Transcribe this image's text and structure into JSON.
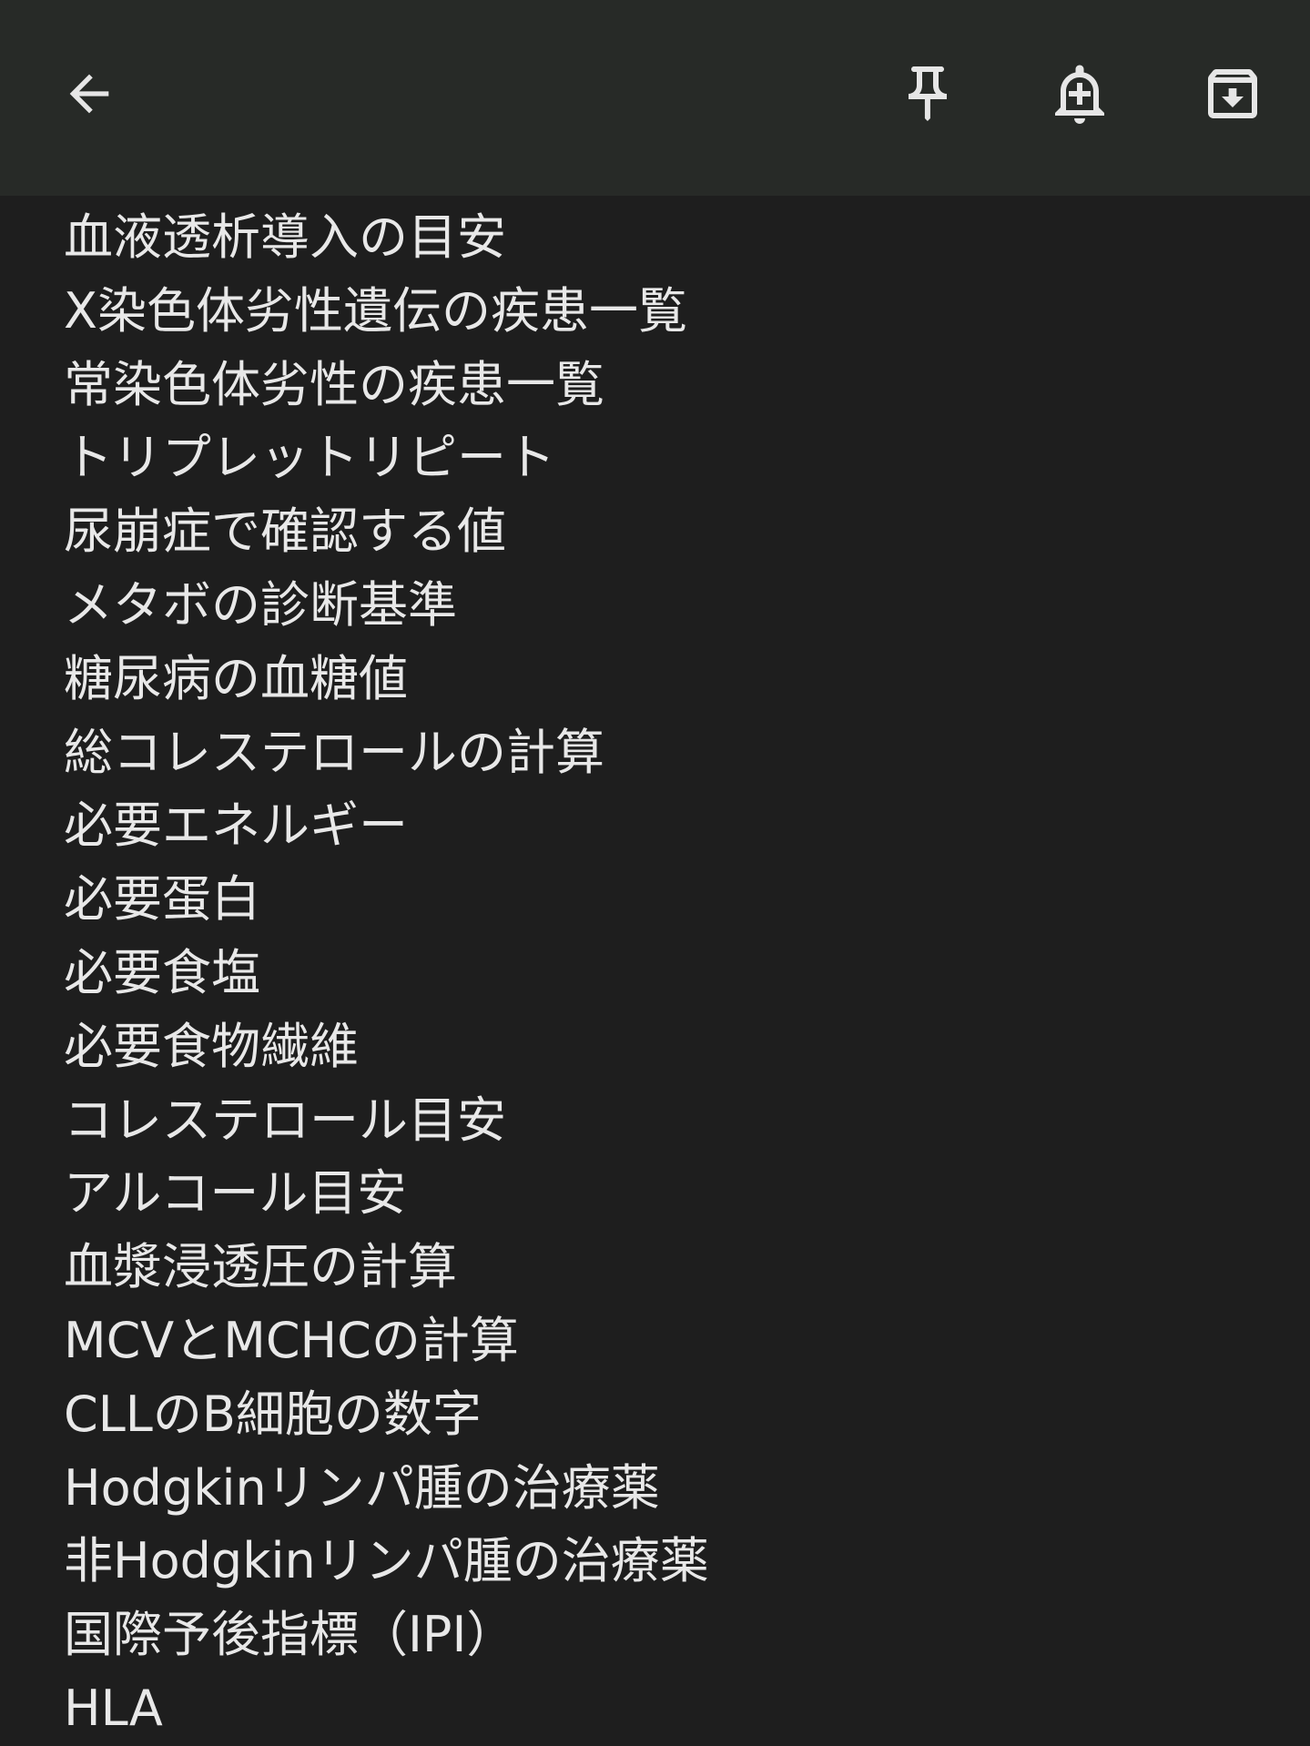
{
  "toolbar": {
    "back_icon": "arrow-back-icon",
    "pin_icon": "pin-icon",
    "reminder_icon": "add-alert-icon",
    "archive_icon": "archive-icon"
  },
  "note": {
    "lines": [
      "血液透析導入の目安",
      "X染色体劣性遺伝の疾患一覧",
      "常染色体劣性の疾患一覧",
      "トリプレットリピート",
      "尿崩症で確認する値",
      "メタボの診断基準",
      "糖尿病の血糖値",
      "総コレステロールの計算",
      "必要エネルギー",
      "必要蛋白",
      "必要食塩",
      "必要食物繊維",
      "コレステロール目安",
      "アルコール目安",
      "血漿浸透圧の計算",
      "MCVとMCHCの計算",
      "CLLのB細胞の数字",
      "Hodgkinリンパ腫の治療薬",
      "非Hodgkinリンパ腫の治療薬",
      "国際予後指標（IPI）",
      "HLA"
    ]
  },
  "colors": {
    "toolbar_bg": "#272a27",
    "body_bg": "#1e1e1e",
    "text": "#e8e8e8",
    "icon": "#e6e6e6"
  }
}
